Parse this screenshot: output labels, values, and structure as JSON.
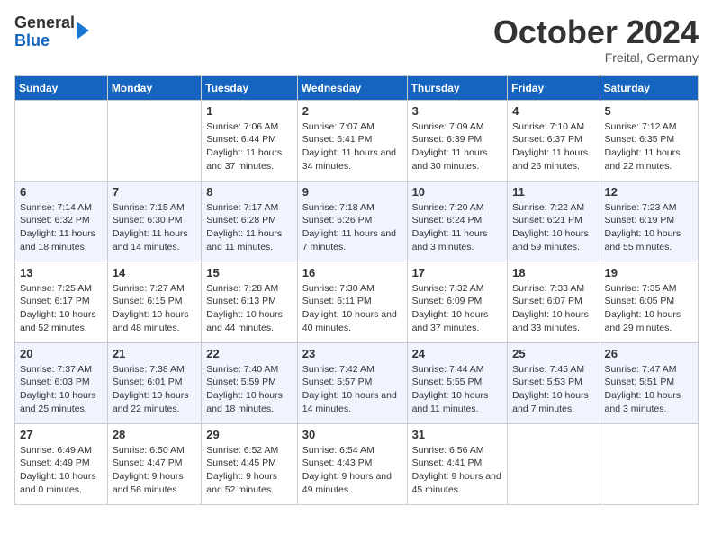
{
  "logo": {
    "general": "General",
    "blue": "Blue"
  },
  "title": "October 2024",
  "subtitle": "Freital, Germany",
  "weekdays": [
    "Sunday",
    "Monday",
    "Tuesday",
    "Wednesday",
    "Thursday",
    "Friday",
    "Saturday"
  ],
  "rows": [
    [
      {
        "day": "",
        "info": ""
      },
      {
        "day": "",
        "info": ""
      },
      {
        "day": "1",
        "info": "Sunrise: 7:06 AM\nSunset: 6:44 PM\nDaylight: 11 hours and 37 minutes."
      },
      {
        "day": "2",
        "info": "Sunrise: 7:07 AM\nSunset: 6:41 PM\nDaylight: 11 hours and 34 minutes."
      },
      {
        "day": "3",
        "info": "Sunrise: 7:09 AM\nSunset: 6:39 PM\nDaylight: 11 hours and 30 minutes."
      },
      {
        "day": "4",
        "info": "Sunrise: 7:10 AM\nSunset: 6:37 PM\nDaylight: 11 hours and 26 minutes."
      },
      {
        "day": "5",
        "info": "Sunrise: 7:12 AM\nSunset: 6:35 PM\nDaylight: 11 hours and 22 minutes."
      }
    ],
    [
      {
        "day": "6",
        "info": "Sunrise: 7:14 AM\nSunset: 6:32 PM\nDaylight: 11 hours and 18 minutes."
      },
      {
        "day": "7",
        "info": "Sunrise: 7:15 AM\nSunset: 6:30 PM\nDaylight: 11 hours and 14 minutes."
      },
      {
        "day": "8",
        "info": "Sunrise: 7:17 AM\nSunset: 6:28 PM\nDaylight: 11 hours and 11 minutes."
      },
      {
        "day": "9",
        "info": "Sunrise: 7:18 AM\nSunset: 6:26 PM\nDaylight: 11 hours and 7 minutes."
      },
      {
        "day": "10",
        "info": "Sunrise: 7:20 AM\nSunset: 6:24 PM\nDaylight: 11 hours and 3 minutes."
      },
      {
        "day": "11",
        "info": "Sunrise: 7:22 AM\nSunset: 6:21 PM\nDaylight: 10 hours and 59 minutes."
      },
      {
        "day": "12",
        "info": "Sunrise: 7:23 AM\nSunset: 6:19 PM\nDaylight: 10 hours and 55 minutes."
      }
    ],
    [
      {
        "day": "13",
        "info": "Sunrise: 7:25 AM\nSunset: 6:17 PM\nDaylight: 10 hours and 52 minutes."
      },
      {
        "day": "14",
        "info": "Sunrise: 7:27 AM\nSunset: 6:15 PM\nDaylight: 10 hours and 48 minutes."
      },
      {
        "day": "15",
        "info": "Sunrise: 7:28 AM\nSunset: 6:13 PM\nDaylight: 10 hours and 44 minutes."
      },
      {
        "day": "16",
        "info": "Sunrise: 7:30 AM\nSunset: 6:11 PM\nDaylight: 10 hours and 40 minutes."
      },
      {
        "day": "17",
        "info": "Sunrise: 7:32 AM\nSunset: 6:09 PM\nDaylight: 10 hours and 37 minutes."
      },
      {
        "day": "18",
        "info": "Sunrise: 7:33 AM\nSunset: 6:07 PM\nDaylight: 10 hours and 33 minutes."
      },
      {
        "day": "19",
        "info": "Sunrise: 7:35 AM\nSunset: 6:05 PM\nDaylight: 10 hours and 29 minutes."
      }
    ],
    [
      {
        "day": "20",
        "info": "Sunrise: 7:37 AM\nSunset: 6:03 PM\nDaylight: 10 hours and 25 minutes."
      },
      {
        "day": "21",
        "info": "Sunrise: 7:38 AM\nSunset: 6:01 PM\nDaylight: 10 hours and 22 minutes."
      },
      {
        "day": "22",
        "info": "Sunrise: 7:40 AM\nSunset: 5:59 PM\nDaylight: 10 hours and 18 minutes."
      },
      {
        "day": "23",
        "info": "Sunrise: 7:42 AM\nSunset: 5:57 PM\nDaylight: 10 hours and 14 minutes."
      },
      {
        "day": "24",
        "info": "Sunrise: 7:44 AM\nSunset: 5:55 PM\nDaylight: 10 hours and 11 minutes."
      },
      {
        "day": "25",
        "info": "Sunrise: 7:45 AM\nSunset: 5:53 PM\nDaylight: 10 hours and 7 minutes."
      },
      {
        "day": "26",
        "info": "Sunrise: 7:47 AM\nSunset: 5:51 PM\nDaylight: 10 hours and 3 minutes."
      }
    ],
    [
      {
        "day": "27",
        "info": "Sunrise: 6:49 AM\nSunset: 4:49 PM\nDaylight: 10 hours and 0 minutes."
      },
      {
        "day": "28",
        "info": "Sunrise: 6:50 AM\nSunset: 4:47 PM\nDaylight: 9 hours and 56 minutes."
      },
      {
        "day": "29",
        "info": "Sunrise: 6:52 AM\nSunset: 4:45 PM\nDaylight: 9 hours and 52 minutes."
      },
      {
        "day": "30",
        "info": "Sunrise: 6:54 AM\nSunset: 4:43 PM\nDaylight: 9 hours and 49 minutes."
      },
      {
        "day": "31",
        "info": "Sunrise: 6:56 AM\nSunset: 4:41 PM\nDaylight: 9 hours and 45 minutes."
      },
      {
        "day": "",
        "info": ""
      },
      {
        "day": "",
        "info": ""
      }
    ]
  ]
}
